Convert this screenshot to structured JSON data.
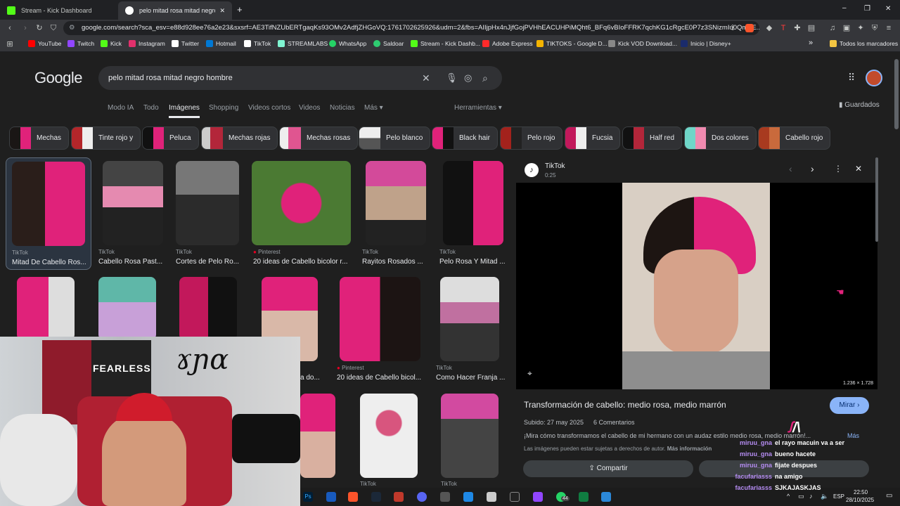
{
  "tabs": [
    {
      "title": "Stream - Kick Dashboard",
      "active": false
    },
    {
      "title": "pelo mitad rosa mitad negro ho…",
      "active": true
    }
  ],
  "window": {
    "new_tab": "+",
    "minimize": "–",
    "restore": "❐",
    "close": "✕"
  },
  "address": {
    "url": "google.com/search?sca_esv=e88d928ee76a2e23&sxsrf=AE3TifNZUbERTgaqKs93OMv2AdfjZHGoVQ:1761702625926&udm=2&fbs=AIIjpHx4nJjfGojPVHhEACUHPiMQht6_BFq6vBIoFFRK7qchKG1cRgcE0P7z3SNizmIu0QmZE..."
  },
  "bookmarks": [
    {
      "label": "YouTube",
      "color": "#ff0000"
    },
    {
      "label": "Twitch",
      "color": "#9146ff"
    },
    {
      "label": "Kick",
      "color": "#53fc18"
    },
    {
      "label": "Instagram",
      "color": "#e1306c"
    },
    {
      "label": "Twitter",
      "color": "#ffffff"
    },
    {
      "label": "Hotmail",
      "color": "#0078d4"
    },
    {
      "label": "TikTok",
      "color": "#ffffff"
    },
    {
      "label": "STREAMLABS",
      "color": "#80f5d2"
    },
    {
      "label": "WhatsApp",
      "color": "#25d366"
    },
    {
      "label": "Saldoar",
      "color": "#2ecc71"
    },
    {
      "label": "Stream - Kick Dashb...",
      "color": "#53fc18"
    },
    {
      "label": "Adobe Express",
      "color": "#ff2a2a"
    },
    {
      "label": "TIKTOKS - Google D...",
      "color": "#f4b400"
    },
    {
      "label": "Kick VOD Download...",
      "color": "#888888"
    },
    {
      "label": "Inicio | Disney+",
      "color": "#1a2b6b"
    }
  ],
  "bookmarks_more": "»",
  "bookmarks_all": "Todos los marcadores",
  "google": {
    "logo": "Google",
    "query": "pelo mitad rosa mitad negro hombre",
    "nav": [
      "Modo IA",
      "Todo",
      "Imágenes",
      "Shopping",
      "Videos cortos",
      "Videos",
      "Noticias",
      "Más ▾"
    ],
    "active_nav": "Imágenes",
    "tools": "Herramientas ▾",
    "saved": "Guardados",
    "chips": [
      "Mechas",
      "Tinte rojo y",
      "Peluca",
      "Mechas rojas",
      "Mechas rosas",
      "Pelo blanco",
      "Black hair",
      "Pelo rojo",
      "Fucsia",
      "Half red",
      "Dos colores",
      "Cabello rojo"
    ]
  },
  "results_row1": [
    {
      "source": "TikTok",
      "title": "Mitad De Cabello Ros..."
    },
    {
      "source": "TikTok",
      "title": "Cabello Rosa Past..."
    },
    {
      "source": "TikTok",
      "title": "Cortes de Pelo Ro..."
    },
    {
      "source": "Pinterest",
      "title": "20 ideas de Cabello bicolor r..."
    },
    {
      "source": "TikTok",
      "title": "Rayitos Rosados ..."
    },
    {
      "source": "TikTok",
      "title": "Pelo Rosa Y Mitad ..."
    }
  ],
  "results_row2": [
    {
      "source": "Pinterest",
      "title": "20 ideas de Cabello bicol..."
    },
    {
      "source": "TikTok",
      "title": "Como Hacer Franja ..."
    }
  ],
  "results_row2_partial": "a do...",
  "results_row3": [
    {
      "source": "TikTok",
      "title": ""
    },
    {
      "source": "TikTok",
      "title": ""
    }
  ],
  "preview": {
    "source": "TikTok",
    "duration": "0:25",
    "dimensions": "1.236 × 1.728",
    "title": "Transformación de cabello: medio rosa, medio marrón",
    "visit_button": "Mirar",
    "meta_date": "Subido: 27 may 2025",
    "meta_comments": "6 Comentarios",
    "description": "¡Mira cómo transformamos el cabello de mi hermano con un audaz estilo medio rosa, medio marrón!...",
    "more_link": "Más",
    "copyright": "Las imágenes pueden estar sujetas a derechos de autor.",
    "more_info": "Más información",
    "share": "Compartir"
  },
  "webcam": {
    "poster_text": "FEARLESS"
  },
  "chat": [
    {
      "user": "miruu_gna",
      "msg": "el rayo macuin va a ser"
    },
    {
      "user": "miruu_gna",
      "msg": "bueno hacete"
    },
    {
      "user": "miruu_gna",
      "msg": "fijate despues"
    },
    {
      "user": "facufariasss",
      "msg": "na amigo"
    },
    {
      "user": "facufariasss",
      "msg": "SJKAJASKJAS"
    }
  ],
  "taskbar": {
    "time": "22:50",
    "date": "28/10/2025",
    "lang": "ESP",
    "badge": "44"
  }
}
